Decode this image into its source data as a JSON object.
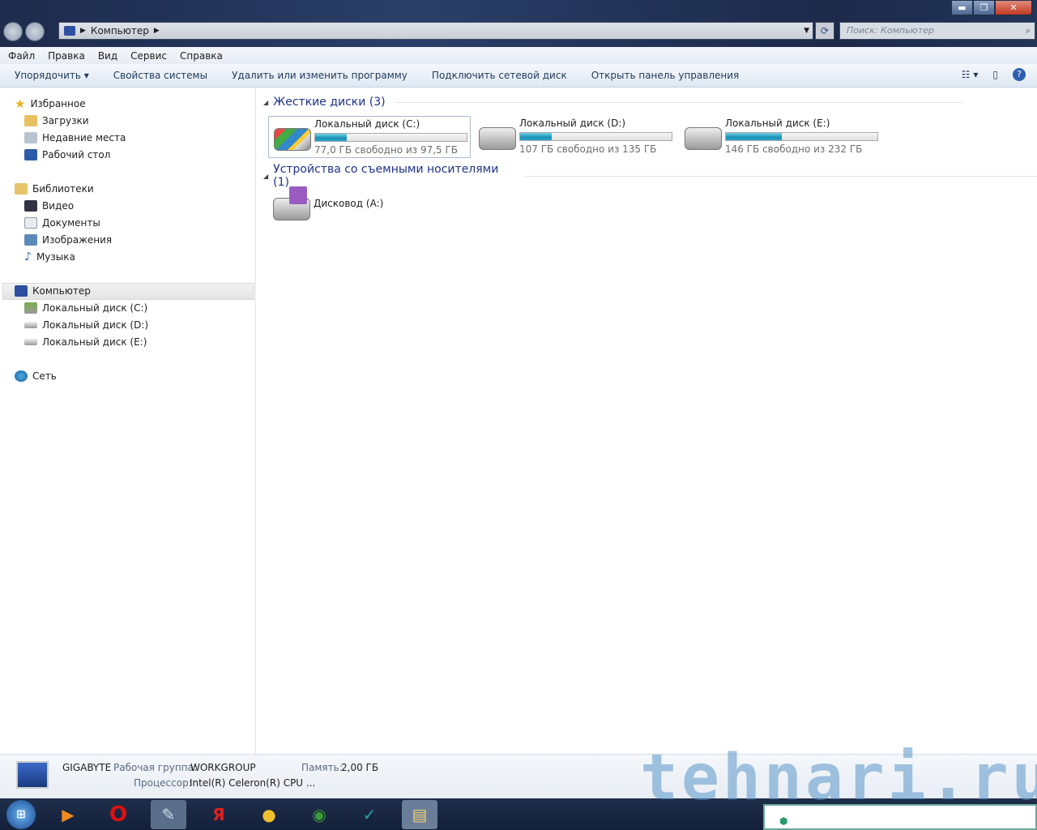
{
  "window": {
    "minimize": "▬",
    "maximize": "❐",
    "close": "✕"
  },
  "address": {
    "crumb": "Компьютер",
    "search_placeholder": "Поиск: Компьютер"
  },
  "menu": [
    "Файл",
    "Правка",
    "Вид",
    "Сервис",
    "Справка"
  ],
  "toolbar": {
    "organize": "Упорядочить ▾",
    "system_props": "Свойства системы",
    "uninstall": "Удалить или изменить программу",
    "map_drive": "Подключить сетевой диск",
    "control_panel": "Открыть панель управления"
  },
  "sidebar": {
    "favorites": {
      "label": "Избранное",
      "items": [
        "Загрузки",
        "Недавние места",
        "Рабочий стол"
      ]
    },
    "libraries": {
      "label": "Библиотеки",
      "items": [
        "Видео",
        "Документы",
        "Изображения",
        "Музыка"
      ]
    },
    "computer": {
      "label": "Компьютер",
      "items": [
        "Локальный диск (C:)",
        "Локальный диск (D:)",
        "Локальный диск (E:)"
      ]
    },
    "network": {
      "label": "Сеть"
    }
  },
  "hard_disks": {
    "title": "Жесткие диски (3)",
    "drives": [
      {
        "name": "Локальный диск (C:)",
        "free": "77,0 ГБ свободно из 97,5 ГБ",
        "used_fraction": 0.21
      },
      {
        "name": "Локальный диск (D:)",
        "free": "107 ГБ свободно из 135 ГБ",
        "used_fraction": 0.207
      },
      {
        "name": "Локальный диск (E:)",
        "free": "146 ГБ свободно из 232 ГБ",
        "used_fraction": 0.37
      }
    ]
  },
  "removable": {
    "title": "Устройства со съемными носителями (1)",
    "drives": [
      {
        "name": "Дисковод (A:)"
      }
    ]
  },
  "details": {
    "name": "GIGABYTE",
    "workgroup_label": "Рабочая группа:",
    "workgroup": "WORKGROUP",
    "memory_label": "Память:",
    "memory": "2,00 ГБ",
    "cpu_label": "Процессор:",
    "cpu": "Intel(R) Celeron(R) CPU ..."
  },
  "watermark": "tehnari.ru",
  "colors": {
    "accent": "#1e3287",
    "bar": "#1a8fb4"
  }
}
